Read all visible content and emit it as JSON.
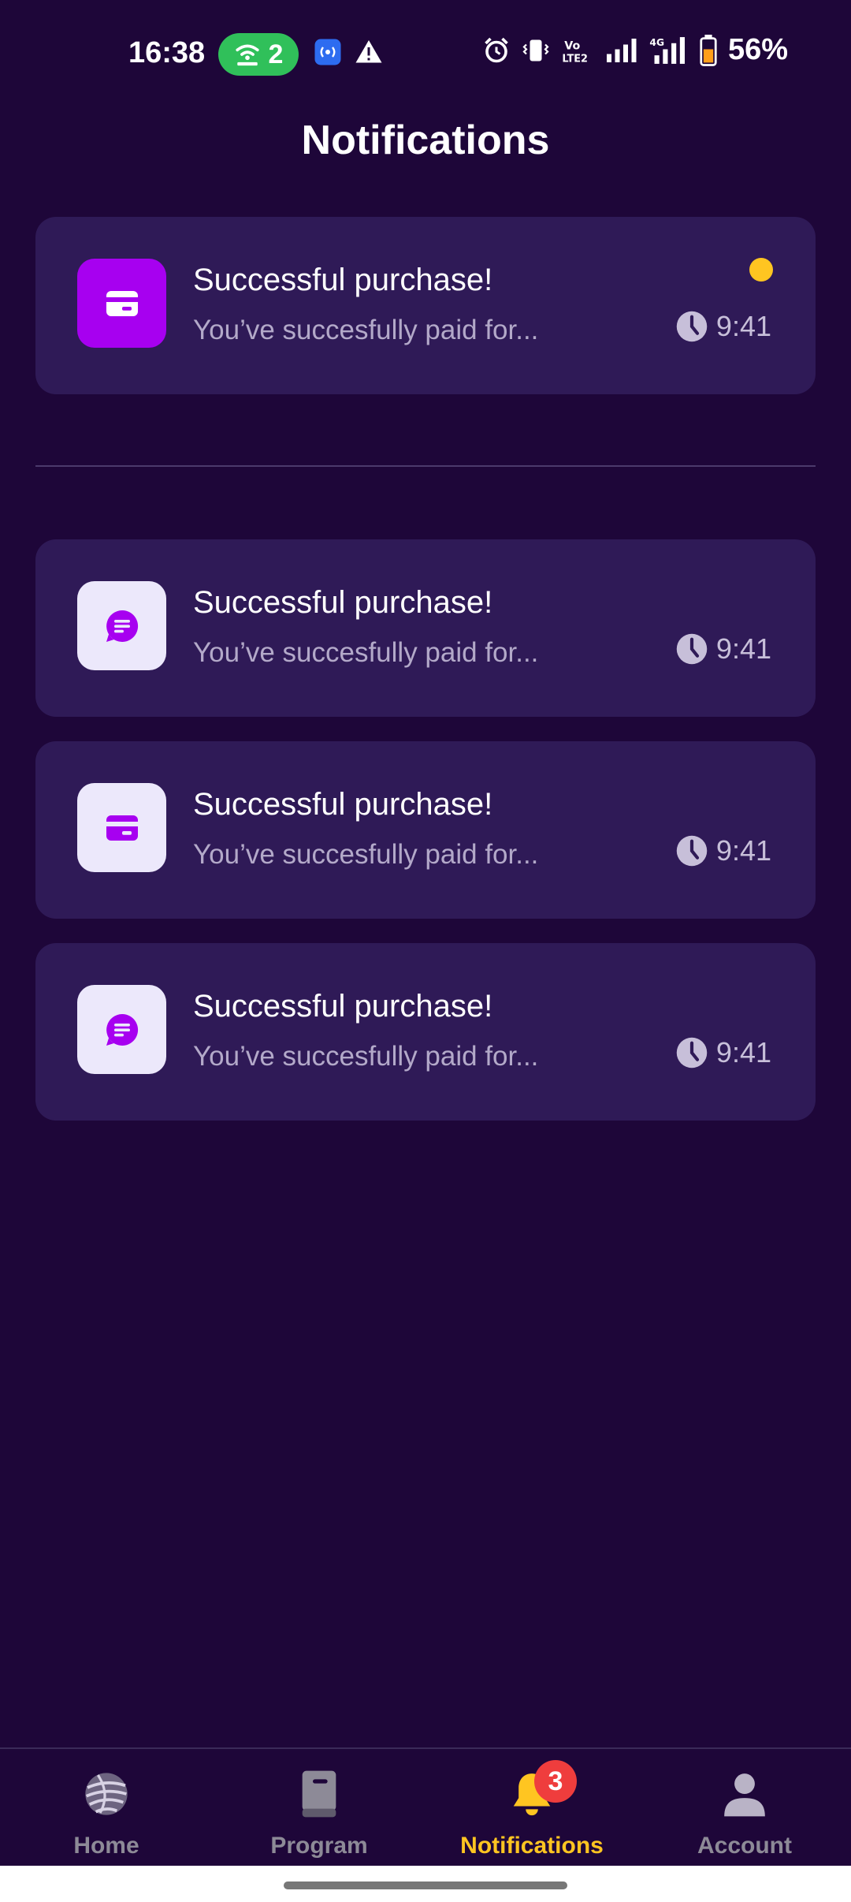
{
  "status_bar": {
    "time": "16:38",
    "hotspot_count": "2",
    "battery": "56%",
    "icons": [
      "hotspot-icon",
      "nfc-icon",
      "warning-icon",
      "alarm-icon",
      "vibrate-icon",
      "volte-icon",
      "signal-icon",
      "signal-4g-icon",
      "battery-icon"
    ]
  },
  "header": {
    "title": "Notifications"
  },
  "notifications": [
    {
      "title": "Successful purchase!",
      "subtitle": "You’ve succesfully paid for...",
      "time": "9:41",
      "icon": "card-icon",
      "unread": true
    },
    {
      "title": "Successful purchase!",
      "subtitle": "You’ve succesfully paid for...",
      "time": "9:41",
      "icon": "message-icon",
      "unread": false
    },
    {
      "title": "Successful purchase!",
      "subtitle": "You’ve succesfully paid for...",
      "time": "9:41",
      "icon": "card-icon",
      "unread": false
    },
    {
      "title": "Successful purchase!",
      "subtitle": "You’ve succesfully paid for...",
      "time": "9:41",
      "icon": "message-icon",
      "unread": false
    }
  ],
  "nav": {
    "items": [
      {
        "label": "Home",
        "icon": "globe-icon"
      },
      {
        "label": "Program",
        "icon": "book-icon"
      },
      {
        "label": "Notifications",
        "icon": "bell-icon",
        "badge": "3"
      },
      {
        "label": "Account",
        "icon": "user-icon"
      }
    ],
    "active": "Notifications"
  },
  "colors": {
    "background": "#1e0639",
    "card": "#2f1a57",
    "accent_purple": "#a700f0",
    "accent_yellow": "#ffc521",
    "badge_red": "#ef3d3d"
  }
}
